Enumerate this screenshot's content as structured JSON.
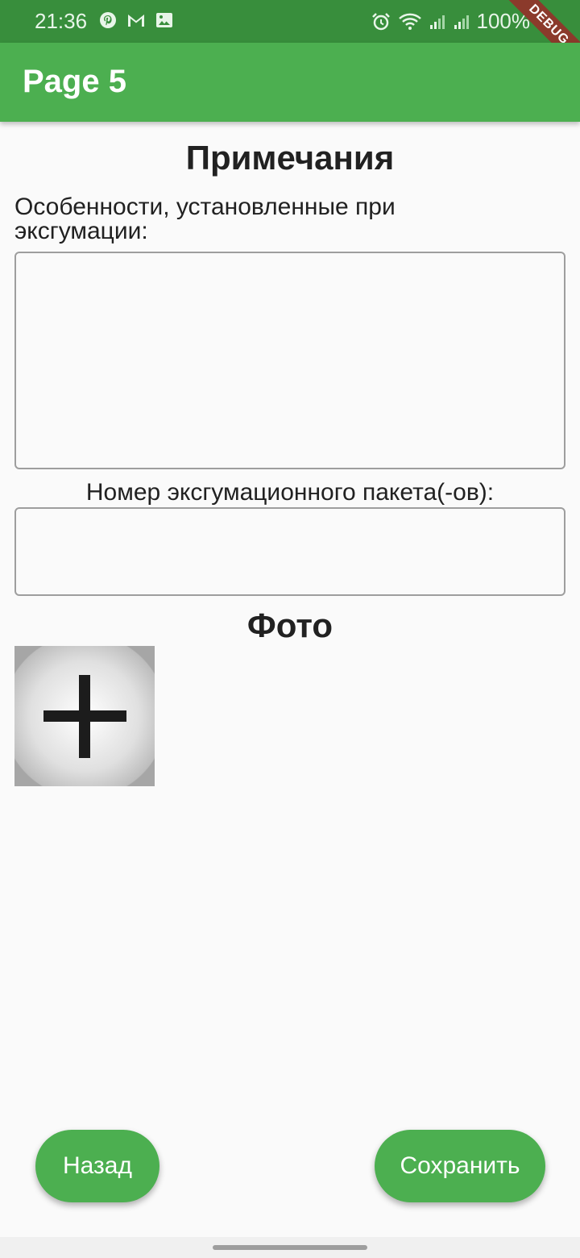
{
  "status_bar": {
    "time": "21:36",
    "left_icons": [
      "pinterest-icon",
      "gmail-icon",
      "image-icon"
    ],
    "right_icons": [
      "alarm-icon",
      "wifi-icon",
      "signal-icon",
      "signal-icon-2"
    ],
    "battery": "100%",
    "debug_banner": "DEBUG"
  },
  "app_bar": {
    "title": "Page 5"
  },
  "notes_section": {
    "title": "Примечания",
    "features_label": "Особенности, установленные при эксгумации:",
    "features_value": "",
    "package_label": "Номер эксгумационного пакета(-ов):",
    "package_value": ""
  },
  "photo_section": {
    "title": "Фото",
    "add_icon": "plus-icon"
  },
  "actions": {
    "back_label": "Назад",
    "save_label": "Сохранить"
  },
  "colors": {
    "status_bar": "#388e3c",
    "app_bar": "#4caf50",
    "button": "#4caf50",
    "background": "#fafafa"
  }
}
